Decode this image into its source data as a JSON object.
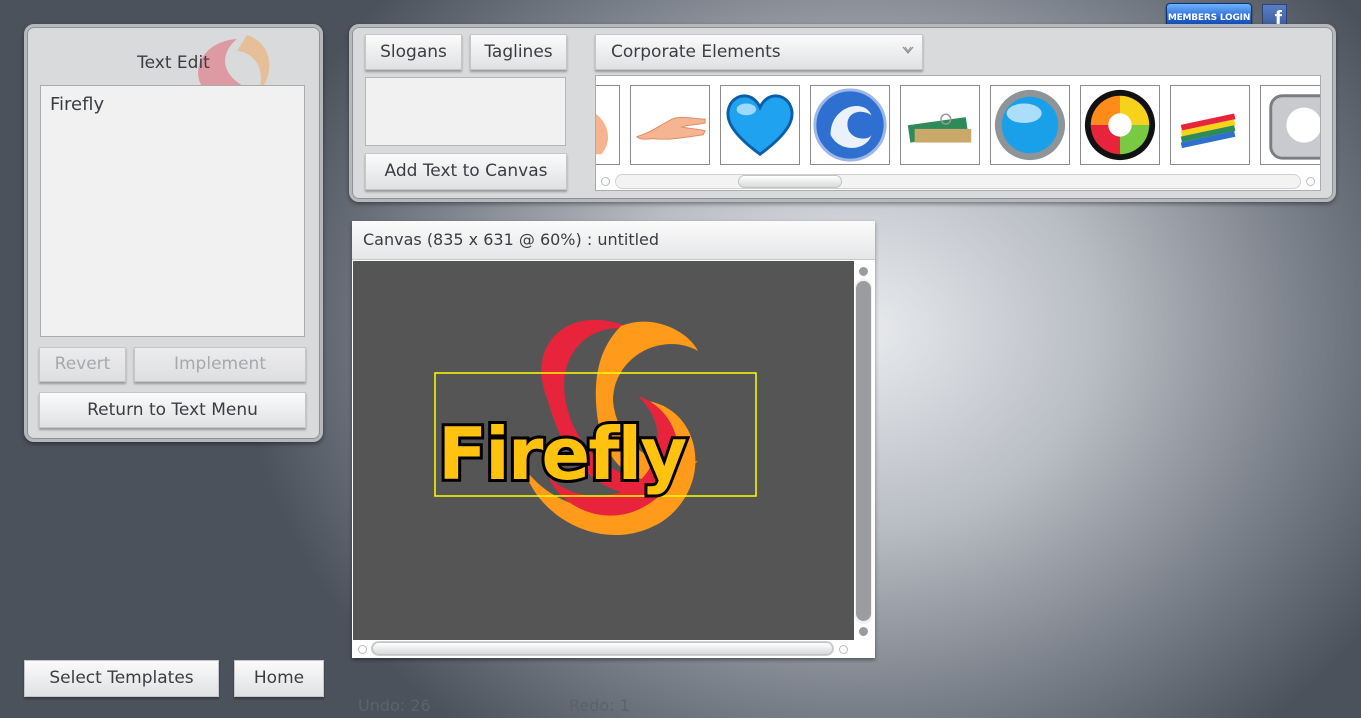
{
  "header": {
    "members_login_label": "MEMBERS LOGIN",
    "facebook_label": "f"
  },
  "text_edit": {
    "title": "Text Edit",
    "content": "Firefly",
    "revert_label": "Revert",
    "implement_label": "Implement",
    "return_label": "Return to Text Menu"
  },
  "toolbar": {
    "slogans_label": "Slogans",
    "taglines_label": "Taglines",
    "add_text_label": "Add Text to Canvas",
    "category_selected": "Corporate Elements"
  },
  "gallery": {
    "items": [
      "hand-partial-icon",
      "open-hand-icon",
      "blue-heart-icon",
      "swirl-globe-icon",
      "wallet-money-icon",
      "blue-orb-icon",
      "color-target-icon",
      "crayons-icon",
      "silver-shape-icon"
    ]
  },
  "canvas": {
    "title": "Canvas (835 x 631 @ 60%) : untitled",
    "logo_text": "Firefly",
    "background_color": "#555555",
    "selection_color": "#ffff00"
  },
  "footer": {
    "select_templates_label": "Select Templates",
    "home_label": "Home",
    "undo_label": "Undo: 26",
    "redo_label": "Redo: 1"
  },
  "colors": {
    "accent_blue": "#1f5ec9",
    "logo_yellow": "#ffc20e",
    "logo_red": "#e8243c",
    "logo_orange": "#ff8c1a"
  }
}
